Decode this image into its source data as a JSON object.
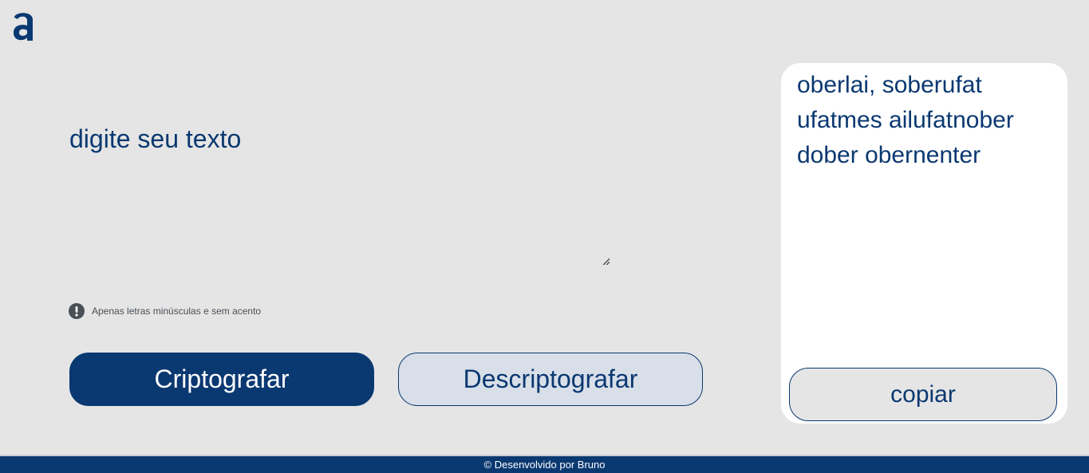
{
  "logo": {
    "icon": "alura-logo-icon",
    "color": "#0a3871"
  },
  "input": {
    "placeholder": "digite seu texto",
    "value": ""
  },
  "hint": {
    "icon": "exclamation-circle-icon",
    "text": "Apenas letras minúsculas e sem acento"
  },
  "buttons": {
    "encrypt_label": "Criptografar",
    "decrypt_label": "Descriptografar"
  },
  "output": {
    "text": "oberlai, soberufat ufatmes ailufatnober dober obernenter",
    "copy_label": "copiar"
  },
  "footer": {
    "text": "© Desenvolvido por Bruno"
  },
  "colors": {
    "primary": "#0a3871",
    "background": "#e5e5e5",
    "secondary_button": "#d8dfe8",
    "panel": "#ffffff"
  }
}
